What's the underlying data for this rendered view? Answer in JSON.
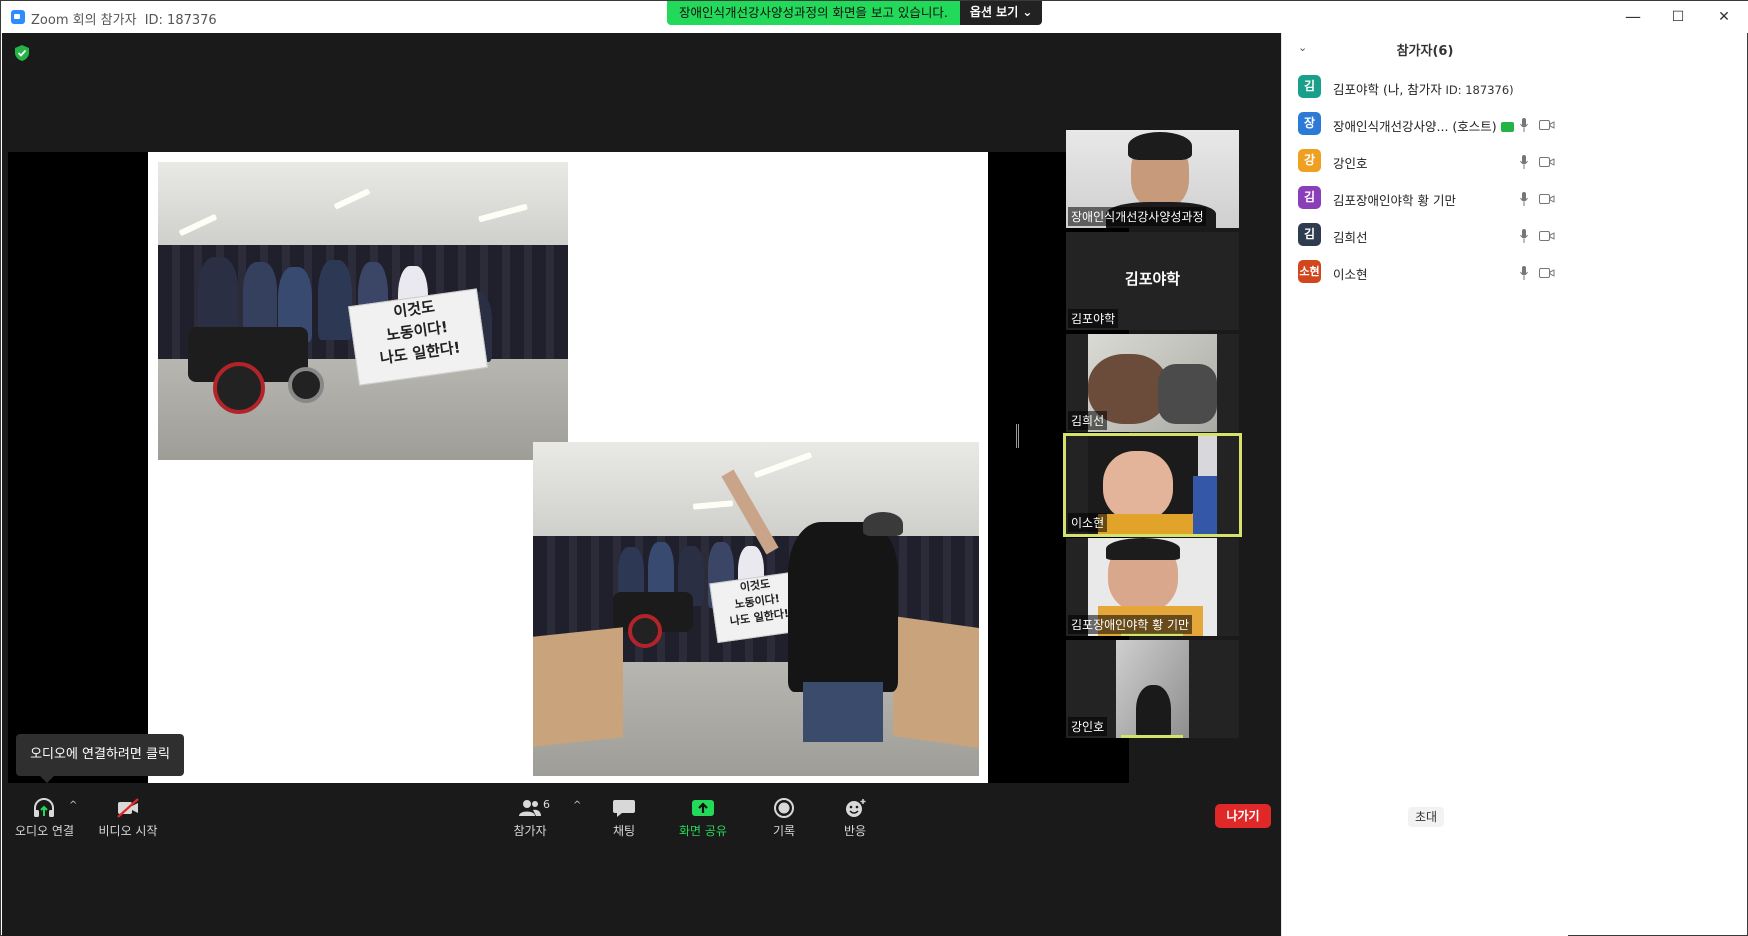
{
  "window": {
    "title": "Zoom 회의 참가자",
    "meeting_id": "ID: 187376",
    "minimize": "—",
    "maximize": "☐",
    "close": "✕"
  },
  "share_banner": {
    "message": "장애인식개선강사양성과정의 화면을 보고 있습니다.",
    "options_label": "옵션 보기 ⌄"
  },
  "view": {
    "gallery_label": "보기"
  },
  "shared_slide": {
    "banner_text_1": "이것도\n노동이다!\n나도 일한다!",
    "banner_text_2": "이것도\n노동이다!\n나도 일한다!"
  },
  "video_tiles": [
    {
      "name": "장애인식개선강사양성과정",
      "type": "video"
    },
    {
      "name": "김포야학",
      "center_label": "김포야학",
      "type": "no-video"
    },
    {
      "name": "김희선",
      "type": "video"
    },
    {
      "name": "이소현",
      "type": "video",
      "active_speaker": true
    },
    {
      "name": "김포장애인야학   황 기만",
      "type": "video"
    },
    {
      "name": "강인호",
      "type": "video"
    }
  ],
  "tooltip": {
    "text": "오디오에 연결하려면 클릭"
  },
  "toolbar": {
    "audio": "오디오 연결",
    "video": "비디오 시작",
    "participants": "참가자",
    "participants_count": "6",
    "chat": "채팅",
    "share": "화면 공유",
    "record": "기록",
    "reactions": "반응",
    "leave": "나가기"
  },
  "participants_panel": {
    "title": "참가자(6)",
    "invite": "초대",
    "items": [
      {
        "initial": "김",
        "color": "#1aa08a",
        "name": "김포야학 (나, 참가자",
        "sub": " ID: 187376)",
        "mic": false,
        "cam": false
      },
      {
        "initial": "장",
        "color": "#2d7ad6",
        "name": "장애인식개선강사양... (호스트)",
        "sub": "",
        "mic": true,
        "cam": true,
        "sharing": true
      },
      {
        "initial": "강",
        "color": "#f0a020",
        "name": "강인호",
        "sub": "",
        "mic": true,
        "cam": true
      },
      {
        "initial": "김",
        "color": "#8a3fb8",
        "name": "김포장애인야학   황 기만",
        "sub": "",
        "mic": true,
        "cam": true
      },
      {
        "initial": "김",
        "color": "#2f3b4f",
        "name": "김희선",
        "sub": "",
        "mic": true,
        "cam": true
      },
      {
        "initial": "소현",
        "color": "#d2461e",
        "name": "이소현",
        "sub": "",
        "mic": true,
        "cam": true
      }
    ]
  },
  "colors": {
    "meeting_bg": "#1a1a1a",
    "share_green": "#23d959",
    "leave_red": "#e02828",
    "active_speaker": "#d6e36b"
  }
}
